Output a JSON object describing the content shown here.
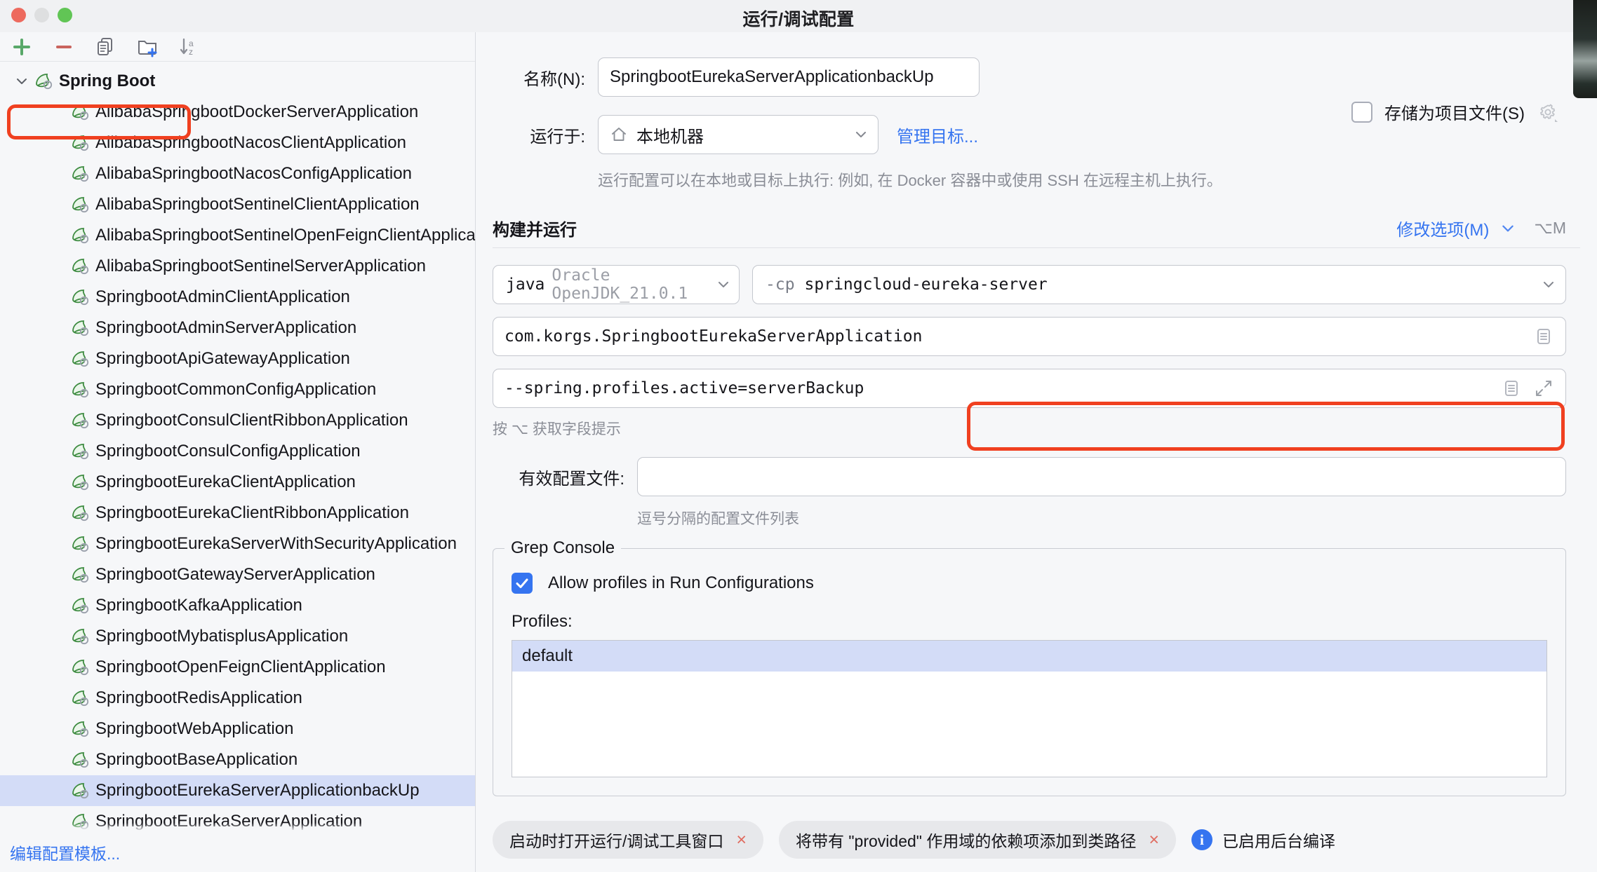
{
  "window": {
    "title": "运行/调试配置",
    "traffic_lights": [
      "close-red",
      "minimize-yellow",
      "zoom-green"
    ]
  },
  "sidebar": {
    "toolbar": [
      {
        "name": "add-configuration-button",
        "icon": "plus-icon",
        "label": "+"
      },
      {
        "name": "remove-configuration-button",
        "icon": "minus-icon",
        "label": "−"
      },
      {
        "name": "copy-configuration-button",
        "icon": "copy-icon",
        "label": ""
      },
      {
        "name": "new-folder-button",
        "icon": "new-folder-icon",
        "label": ""
      },
      {
        "name": "sort-configurations-button",
        "icon": "sort-az-icon",
        "label": ""
      }
    ],
    "root": {
      "label": "Spring Boot",
      "expanded": true,
      "icon": "spring-boot-icon",
      "highlighted": true
    },
    "items": [
      "AlibabaSpringbootDockerServerApplication",
      "AlibabaSpringbootNacosClientApplication",
      "AlibabaSpringbootNacosConfigApplication",
      "AlibabaSpringbootSentinelClientApplication",
      "AlibabaSpringbootSentinelOpenFeignClientApplication",
      "AlibabaSpringbootSentinelServerApplication",
      "SpringbootAdminClientApplication",
      "SpringbootAdminServerApplication",
      "SpringbootApiGatewayApplication",
      "SpringbootCommonConfigApplication",
      "SpringbootConsulClientRibbonApplication",
      "SpringbootConsulConfigApplication",
      "SpringbootEurekaClientApplication",
      "SpringbootEurekaClientRibbonApplication",
      "SpringbootEurekaServerWithSecurityApplication",
      "SpringbootGatewayServerApplication",
      "SpringbootKafkaApplication",
      "SpringbootMybatisplusApplication",
      "SpringbootOpenFeignClientApplication",
      "SpringbootRedisApplication",
      "SpringbootWebApplication",
      "SpringbootBaseApplication",
      "SpringbootEurekaServerApplicationbackUp",
      "SpringbootEurekaServerApplication"
    ],
    "selected_index": 22,
    "footer_link": "编辑配置模板..."
  },
  "form": {
    "name_label": "名称(N):",
    "name_value": "SpringbootEurekaServerApplicationbackUp",
    "save_as_project_file_label": "存储为项目文件(S)",
    "save_as_project_file_checked": false,
    "gear_icon": "gear-icon",
    "run_on_label": "运行于:",
    "run_on_value": "本地机器",
    "run_on_icon": "home-icon",
    "manage_targets_link": "管理目标...",
    "run_on_description": "运行配置可以在本地或目标上执行: 例如, 在 Docker 容器中或使用 SSH 在远程主机上执行。",
    "build_and_run_title": "构建并运行",
    "modify_options_link": "修改选项(M)",
    "modify_options_shortcut": "⌥M",
    "jdk_prefix": "java",
    "jdk_value": "Oracle OpenJDK_21.0.1",
    "classpath_flag": "-cp",
    "classpath_value": "springcloud-eureka-server",
    "main_class_value": "com.korgs.SpringbootEurekaServerApplication",
    "program_args_value": "--spring.profiles.active=serverBackup",
    "program_args_highlighted": true,
    "field_hint": "按 ⌥ 获取字段提示",
    "active_profiles_label": "有效配置文件:",
    "active_profiles_value": "",
    "active_profiles_hint": "逗号分隔的配置文件列表",
    "expand_icon": "expand-icon",
    "editor_icon": "multiline-editor-icon"
  },
  "grep_console": {
    "legend": "Grep Console",
    "allow_profiles_label": "Allow profiles in Run Configurations",
    "allow_profiles_checked": true,
    "profiles_label": "Profiles:",
    "profiles": [
      "default"
    ],
    "selected_profile": "default"
  },
  "bottom": {
    "chips": [
      {
        "label": "启动时打开运行/调试工具窗口",
        "close": "×"
      },
      {
        "label": "将带有 \"provided\" 作用域的依赖项添加到类路径",
        "close": "×"
      }
    ],
    "info_icon": "info-icon",
    "info_text": "已启用后台编译"
  },
  "colors": {
    "accent": "#3574f0",
    "highlight_box": "#f04020",
    "selection": "#d3dcf7",
    "spring_green": "#3d8b40"
  }
}
